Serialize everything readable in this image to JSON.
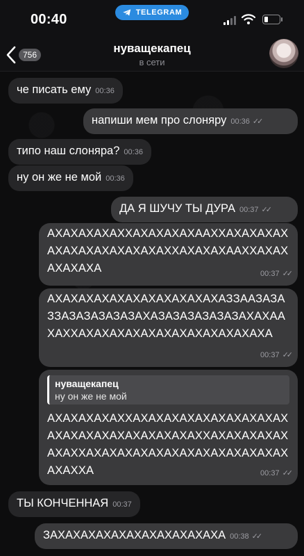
{
  "status": {
    "time": "00:40",
    "app_pill": "TELEGRAM"
  },
  "header": {
    "back_badge": "756",
    "title": "нуващекапец",
    "subtitle": "в сети"
  },
  "messages": [
    {
      "dir": "in",
      "text": "че писать ему",
      "time": "00:36"
    },
    {
      "dir": "out",
      "text": "напиши мем про слоняру",
      "time": "00:36"
    },
    {
      "dir": "in",
      "text": "типо наш слоняра?",
      "time": "00:36"
    },
    {
      "dir": "in",
      "text": "ну он же не мой",
      "time": "00:36"
    },
    {
      "dir": "out",
      "text": "ДА Я ШУЧУ ТЫ ДУРА",
      "time": "00:37"
    },
    {
      "dir": "out",
      "text": "АХАХАХАХАХХАХАХАХАХААХХАХАХАХАХАХАХАХАХАХАХАХАХХАХАХАХААХХАХАХАХАХАХА",
      "time": "00:37"
    },
    {
      "dir": "out",
      "text": "АХАХАХАХАХАХАХАХАХАХАХАЗЗААЗАЗАЗЗАЗАЗАЗАЗАЗАХАЗАЗАЗАЗАЗАЗАХАХААХАХХАХАХАХАХАХАХАХАХАХАХАХАХА",
      "time": "00:37"
    },
    {
      "dir": "out",
      "reply_name": "нуващекапец",
      "reply_text": "ну он же не мой",
      "text": "АХАХАХАХАХХАХАХАХАХАХАХАХАХАХАХАХАХАХАХАХАХАХАХАХАХХАХАХАХАХАХАХАХХАХАХАХАХАХАХАХАХАХАХАХАХАХАХАХХА",
      "time": "00:37"
    },
    {
      "dir": "in",
      "text": "ТЫ КОНЧЕННАЯ",
      "time": "00:37"
    },
    {
      "dir": "out",
      "text": "ЗАХАХАХАХАХАХАХАХАХАХАХА",
      "time": "00:38"
    }
  ]
}
